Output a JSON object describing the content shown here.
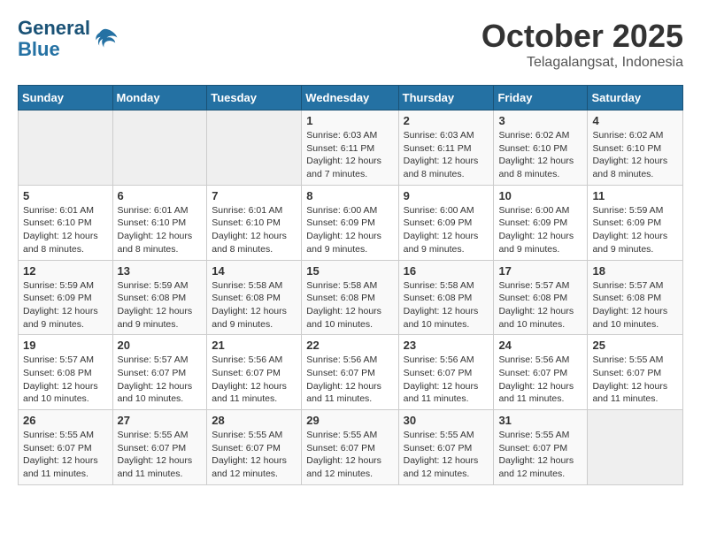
{
  "header": {
    "logo_line1": "General",
    "logo_line2": "Blue",
    "title": "October 2025",
    "subtitle": "Telagalangsat, Indonesia"
  },
  "weekdays": [
    "Sunday",
    "Monday",
    "Tuesday",
    "Wednesday",
    "Thursday",
    "Friday",
    "Saturday"
  ],
  "weeks": [
    [
      {
        "day": "",
        "info": ""
      },
      {
        "day": "",
        "info": ""
      },
      {
        "day": "",
        "info": ""
      },
      {
        "day": "1",
        "info": "Sunrise: 6:03 AM\nSunset: 6:11 PM\nDaylight: 12 hours\nand 7 minutes."
      },
      {
        "day": "2",
        "info": "Sunrise: 6:03 AM\nSunset: 6:11 PM\nDaylight: 12 hours\nand 8 minutes."
      },
      {
        "day": "3",
        "info": "Sunrise: 6:02 AM\nSunset: 6:10 PM\nDaylight: 12 hours\nand 8 minutes."
      },
      {
        "day": "4",
        "info": "Sunrise: 6:02 AM\nSunset: 6:10 PM\nDaylight: 12 hours\nand 8 minutes."
      }
    ],
    [
      {
        "day": "5",
        "info": "Sunrise: 6:01 AM\nSunset: 6:10 PM\nDaylight: 12 hours\nand 8 minutes."
      },
      {
        "day": "6",
        "info": "Sunrise: 6:01 AM\nSunset: 6:10 PM\nDaylight: 12 hours\nand 8 minutes."
      },
      {
        "day": "7",
        "info": "Sunrise: 6:01 AM\nSunset: 6:10 PM\nDaylight: 12 hours\nand 8 minutes."
      },
      {
        "day": "8",
        "info": "Sunrise: 6:00 AM\nSunset: 6:09 PM\nDaylight: 12 hours\nand 9 minutes."
      },
      {
        "day": "9",
        "info": "Sunrise: 6:00 AM\nSunset: 6:09 PM\nDaylight: 12 hours\nand 9 minutes."
      },
      {
        "day": "10",
        "info": "Sunrise: 6:00 AM\nSunset: 6:09 PM\nDaylight: 12 hours\nand 9 minutes."
      },
      {
        "day": "11",
        "info": "Sunrise: 5:59 AM\nSunset: 6:09 PM\nDaylight: 12 hours\nand 9 minutes."
      }
    ],
    [
      {
        "day": "12",
        "info": "Sunrise: 5:59 AM\nSunset: 6:09 PM\nDaylight: 12 hours\nand 9 minutes."
      },
      {
        "day": "13",
        "info": "Sunrise: 5:59 AM\nSunset: 6:08 PM\nDaylight: 12 hours\nand 9 minutes."
      },
      {
        "day": "14",
        "info": "Sunrise: 5:58 AM\nSunset: 6:08 PM\nDaylight: 12 hours\nand 9 minutes."
      },
      {
        "day": "15",
        "info": "Sunrise: 5:58 AM\nSunset: 6:08 PM\nDaylight: 12 hours\nand 10 minutes."
      },
      {
        "day": "16",
        "info": "Sunrise: 5:58 AM\nSunset: 6:08 PM\nDaylight: 12 hours\nand 10 minutes."
      },
      {
        "day": "17",
        "info": "Sunrise: 5:57 AM\nSunset: 6:08 PM\nDaylight: 12 hours\nand 10 minutes."
      },
      {
        "day": "18",
        "info": "Sunrise: 5:57 AM\nSunset: 6:08 PM\nDaylight: 12 hours\nand 10 minutes."
      }
    ],
    [
      {
        "day": "19",
        "info": "Sunrise: 5:57 AM\nSunset: 6:08 PM\nDaylight: 12 hours\nand 10 minutes."
      },
      {
        "day": "20",
        "info": "Sunrise: 5:57 AM\nSunset: 6:07 PM\nDaylight: 12 hours\nand 10 minutes."
      },
      {
        "day": "21",
        "info": "Sunrise: 5:56 AM\nSunset: 6:07 PM\nDaylight: 12 hours\nand 11 minutes."
      },
      {
        "day": "22",
        "info": "Sunrise: 5:56 AM\nSunset: 6:07 PM\nDaylight: 12 hours\nand 11 minutes."
      },
      {
        "day": "23",
        "info": "Sunrise: 5:56 AM\nSunset: 6:07 PM\nDaylight: 12 hours\nand 11 minutes."
      },
      {
        "day": "24",
        "info": "Sunrise: 5:56 AM\nSunset: 6:07 PM\nDaylight: 12 hours\nand 11 minutes."
      },
      {
        "day": "25",
        "info": "Sunrise: 5:55 AM\nSunset: 6:07 PM\nDaylight: 12 hours\nand 11 minutes."
      }
    ],
    [
      {
        "day": "26",
        "info": "Sunrise: 5:55 AM\nSunset: 6:07 PM\nDaylight: 12 hours\nand 11 minutes."
      },
      {
        "day": "27",
        "info": "Sunrise: 5:55 AM\nSunset: 6:07 PM\nDaylight: 12 hours\nand 11 minutes."
      },
      {
        "day": "28",
        "info": "Sunrise: 5:55 AM\nSunset: 6:07 PM\nDaylight: 12 hours\nand 12 minutes."
      },
      {
        "day": "29",
        "info": "Sunrise: 5:55 AM\nSunset: 6:07 PM\nDaylight: 12 hours\nand 12 minutes."
      },
      {
        "day": "30",
        "info": "Sunrise: 5:55 AM\nSunset: 6:07 PM\nDaylight: 12 hours\nand 12 minutes."
      },
      {
        "day": "31",
        "info": "Sunrise: 5:55 AM\nSunset: 6:07 PM\nDaylight: 12 hours\nand 12 minutes."
      },
      {
        "day": "",
        "info": ""
      }
    ]
  ]
}
